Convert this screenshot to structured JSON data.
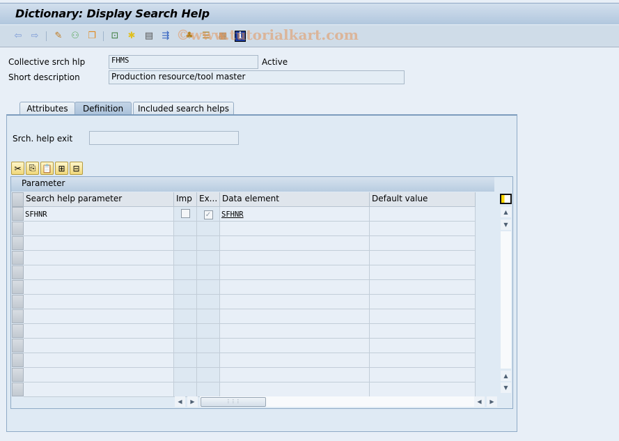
{
  "window": {
    "title": "Dictionary: Display Search Help"
  },
  "toolbar": {
    "icons": [
      {
        "name": "back-arrow-icon",
        "glyph": "⇦",
        "color": "#7b9ad6"
      },
      {
        "name": "forward-arrow-icon",
        "glyph": "⇨",
        "color": "#7b9ad6"
      },
      {
        "name": "display-change-icon",
        "glyph": "✎",
        "color": "#c07a20"
      },
      {
        "name": "active-inactive-icon",
        "glyph": "⚇",
        "color": "#5aa85a"
      },
      {
        "name": "other-object-icon",
        "glyph": "❐",
        "color": "#e08a20"
      },
      {
        "name": "check-icon",
        "glyph": "⊡",
        "color": "#3a7a3a"
      },
      {
        "name": "activate-icon",
        "glyph": "✱",
        "color": "#e0c020"
      },
      {
        "name": "test-icon",
        "glyph": "▤",
        "color": "#555"
      },
      {
        "name": "where-used-icon",
        "glyph": "⇶",
        "color": "#3060c0"
      },
      {
        "name": "hierarchy-icon",
        "glyph": "♣",
        "color": "#b08020"
      },
      {
        "name": "object-list-icon",
        "glyph": "☰",
        "color": "#b08020"
      },
      {
        "name": "display-object-icon",
        "glyph": "▦",
        "color": "#b07a40"
      },
      {
        "name": "info-icon",
        "glyph": "i",
        "color": "#1a3aa0"
      }
    ],
    "watermark": "©www.tutorialkart.com"
  },
  "header": {
    "collective_label": "Collective srch hlp",
    "collective_value": "FHMS",
    "status": "Active",
    "short_desc_label": "Short description",
    "short_desc_value": "Production resource/tool master"
  },
  "tabs": [
    {
      "label": "Attributes",
      "active": false
    },
    {
      "label": "Definition",
      "active": true
    },
    {
      "label": "Included search helps",
      "active": false
    }
  ],
  "definition": {
    "exit_label": "Srch. help exit",
    "exit_value": "",
    "grid_toolbar": [
      {
        "name": "cut-icon",
        "glyph": "✂"
      },
      {
        "name": "copy-icon",
        "glyph": "⎘"
      },
      {
        "name": "paste-icon",
        "glyph": "📋"
      },
      {
        "name": "insert-row-icon",
        "glyph": "⊞"
      },
      {
        "name": "delete-row-icon",
        "glyph": "⊟"
      }
    ],
    "grid": {
      "title": "Parameter",
      "columns": [
        "Search help parameter",
        "Imp",
        "Ex...",
        "Data element",
        "Default value"
      ],
      "rows": [
        {
          "param": "SFHNR",
          "imp": false,
          "exp": true,
          "data_element": "SFHNR",
          "default": ""
        },
        {
          "param": "",
          "imp": null,
          "exp": null,
          "data_element": "",
          "default": ""
        },
        {
          "param": "",
          "imp": null,
          "exp": null,
          "data_element": "",
          "default": ""
        },
        {
          "param": "",
          "imp": null,
          "exp": null,
          "data_element": "",
          "default": ""
        },
        {
          "param": "",
          "imp": null,
          "exp": null,
          "data_element": "",
          "default": ""
        },
        {
          "param": "",
          "imp": null,
          "exp": null,
          "data_element": "",
          "default": ""
        },
        {
          "param": "",
          "imp": null,
          "exp": null,
          "data_element": "",
          "default": ""
        },
        {
          "param": "",
          "imp": null,
          "exp": null,
          "data_element": "",
          "default": ""
        },
        {
          "param": "",
          "imp": null,
          "exp": null,
          "data_element": "",
          "default": ""
        },
        {
          "param": "",
          "imp": null,
          "exp": null,
          "data_element": "",
          "default": ""
        },
        {
          "param": "",
          "imp": null,
          "exp": null,
          "data_element": "",
          "default": ""
        },
        {
          "param": "",
          "imp": null,
          "exp": null,
          "data_element": "",
          "default": ""
        },
        {
          "param": "",
          "imp": null,
          "exp": null,
          "data_element": "",
          "default": ""
        }
      ]
    }
  }
}
